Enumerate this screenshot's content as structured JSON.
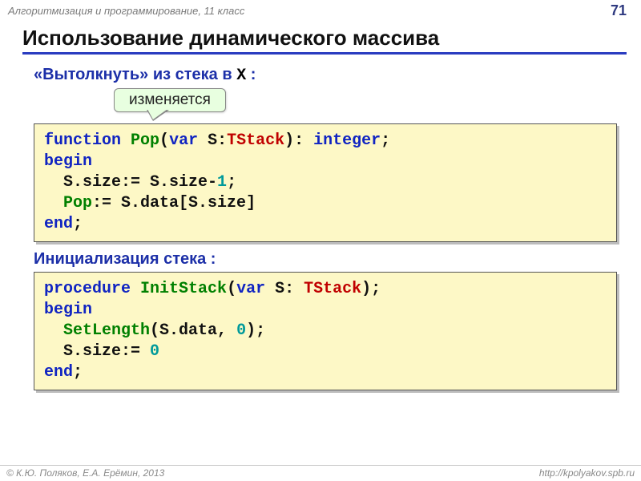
{
  "header": {
    "course": "Алгоритмизация и программирование, 11 класс",
    "page": "71"
  },
  "title": "Использование динамического массива",
  "section1": {
    "label_prefix": "«Вытолкнуть» из стека в ",
    "label_var": "X",
    "label_suffix": " :",
    "callout": "изменяется"
  },
  "code1": {
    "l1": {
      "a": "function ",
      "b": "Pop",
      "c": "(",
      "d": "var",
      "e": " S:",
      "f": "TStack",
      "g": "): ",
      "h": "integer",
      "i": ";"
    },
    "l2": "begin",
    "l3": {
      "a": "  S.size:= S.size-",
      "b": "1",
      "c": ";"
    },
    "l4": {
      "a": "  ",
      "b": "Pop",
      "c": ":= S.data[S.size]"
    },
    "l5": {
      "a": "end",
      "b": ";"
    }
  },
  "section2": {
    "label": "Инициализация стека :"
  },
  "code2": {
    "l1": {
      "a": "procedure ",
      "b": "InitStack",
      "c": "(",
      "d": "var",
      "e": " S: ",
      "f": "TStack",
      "g": ");"
    },
    "l2": "begin",
    "l3": {
      "a": "  ",
      "b": "SetLength",
      "c": "(S.data, ",
      "d": "0",
      "e": ");"
    },
    "l4": {
      "a": "  S.size:= ",
      "b": "0"
    },
    "l5": {
      "a": "end",
      "b": ";"
    }
  },
  "footer": {
    "left": "© К.Ю. Поляков, Е.А. Ерёмин, 2013",
    "right": "http://kpolyakov.spb.ru"
  }
}
